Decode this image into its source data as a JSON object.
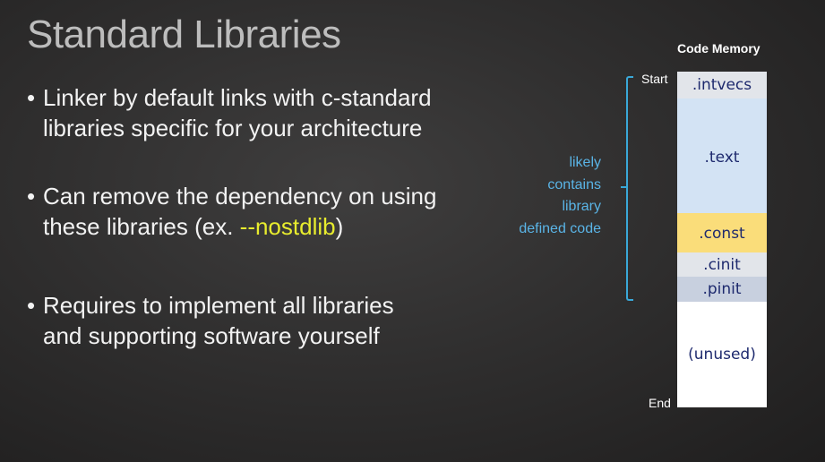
{
  "slide": {
    "title": "Standard Libraries",
    "bullets": [
      {
        "line1": "Linker by default links with c-standard",
        "line2": "libraries specific for your architecture"
      },
      {
        "line1": "Can remove the dependency on using",
        "line2_prefix": "these libraries (ex. ",
        "line2_highlight": "--nostdlib",
        "line2_suffix": ")"
      },
      {
        "line1": "Requires to implement all libraries",
        "line2": "and supporting software yourself"
      }
    ],
    "bullet_symbol": "•"
  },
  "diagram": {
    "title": "Code Memory",
    "start_label": "Start",
    "end_label": "End",
    "bracket_note": [
      "likely",
      "contains",
      "library",
      "defined code"
    ],
    "segments": [
      ".intvecs",
      ".text",
      ".const",
      ".cinit",
      ".pinit",
      "(unused)"
    ]
  },
  "colors": {
    "highlight": "#e8ec2e",
    "bracket": "#3aa8d8",
    "segment_text": "#1e2a6e",
    "const_fill": "#fadd7a",
    "text_fill": "#d3e3f4"
  }
}
